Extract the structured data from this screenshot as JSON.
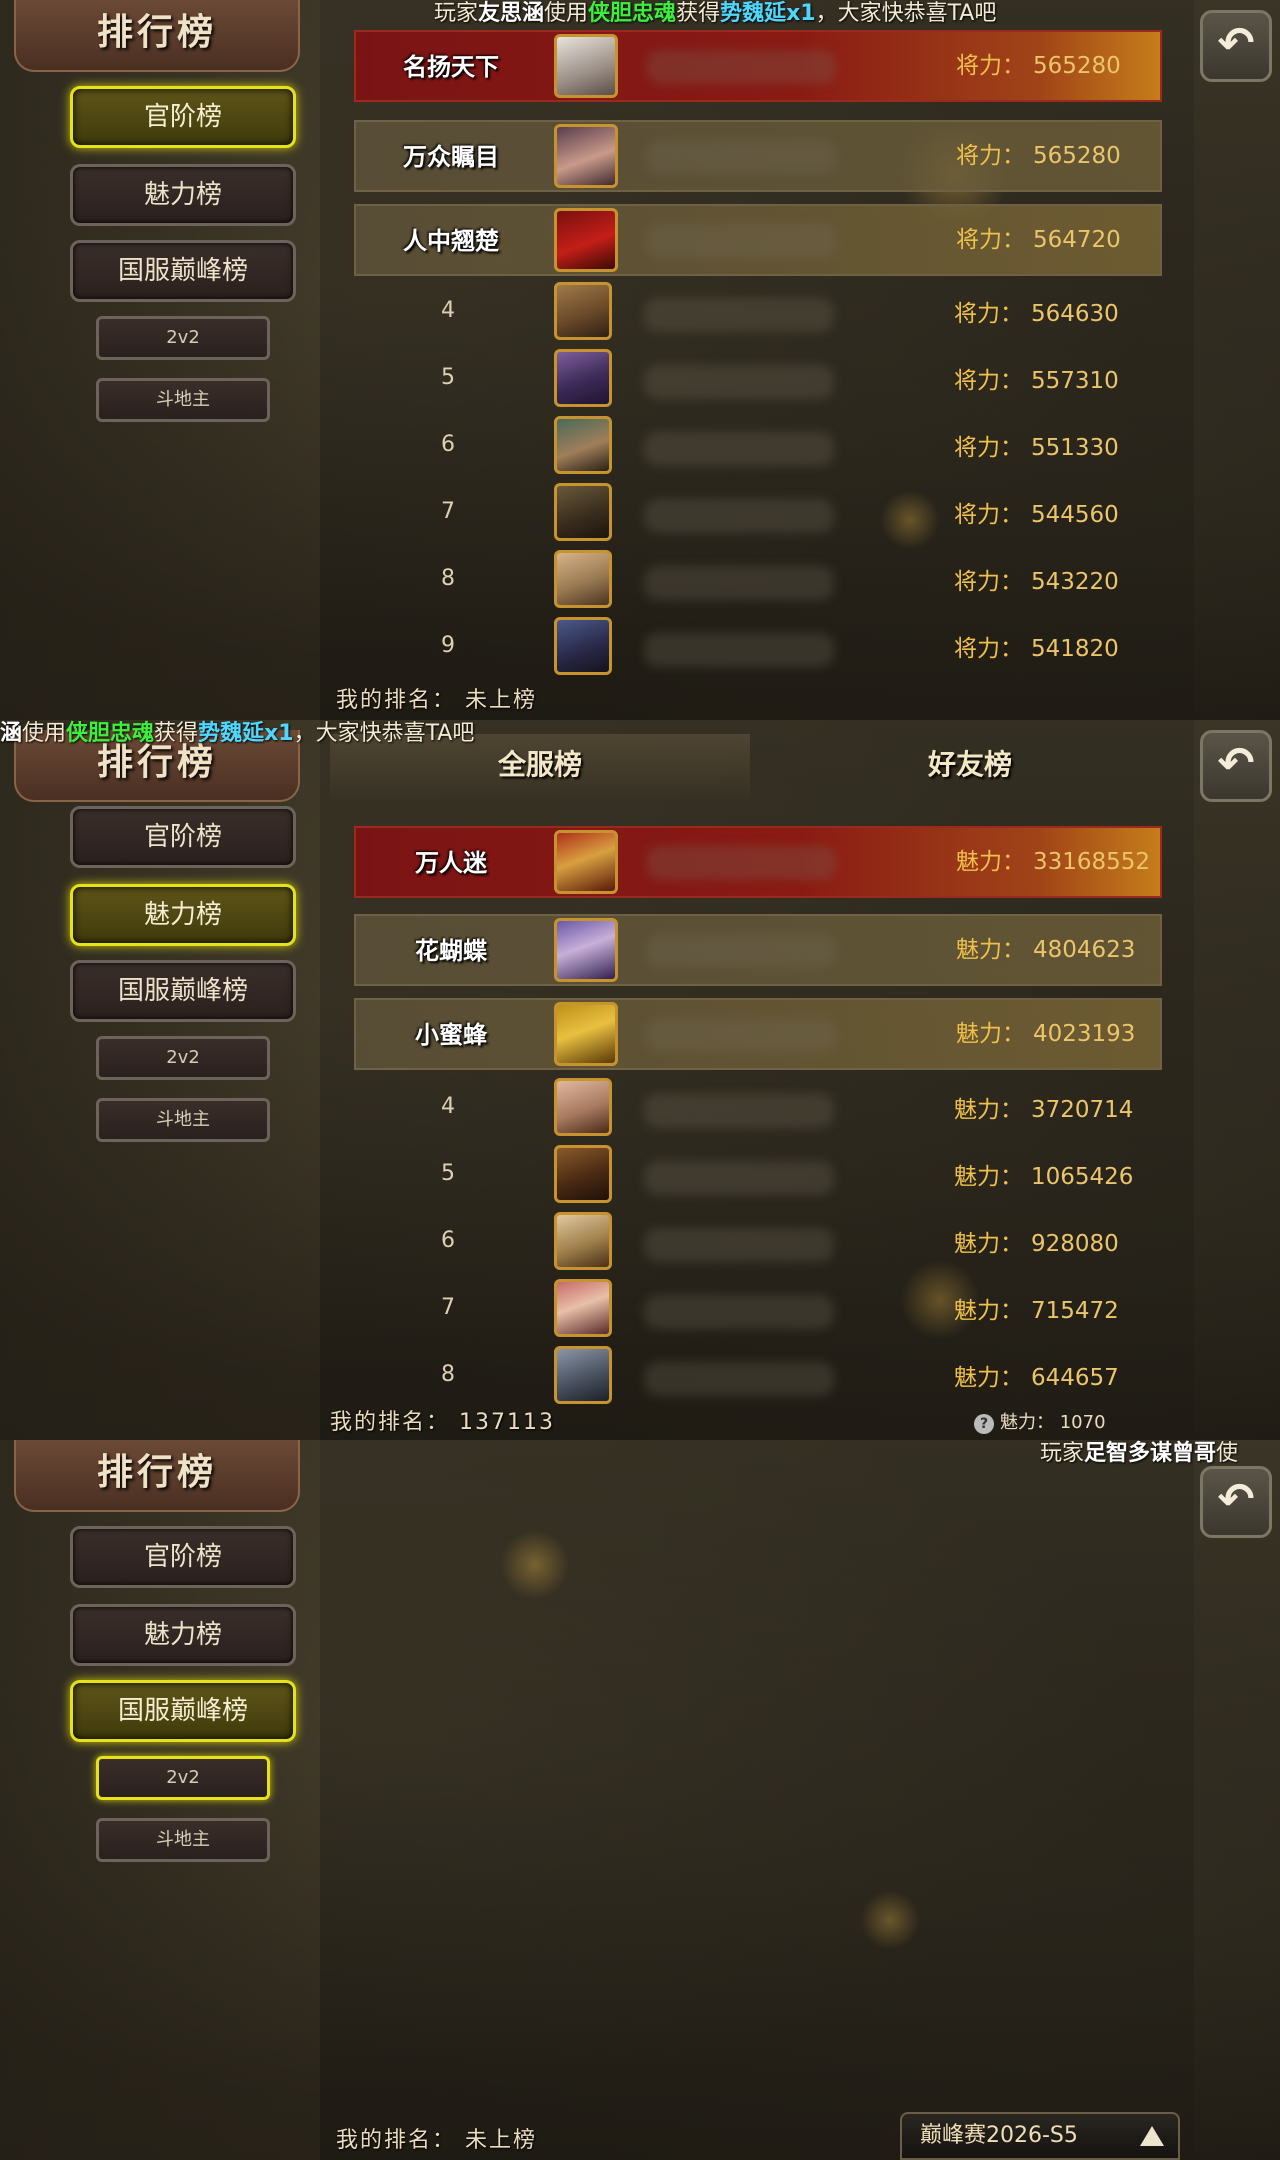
{
  "app": {
    "title": "排行榜",
    "back_icon": "↶"
  },
  "sidebar": {
    "title": "排行榜",
    "items": [
      {
        "label": "官阶榜"
      },
      {
        "label": "魅力榜"
      },
      {
        "label": "国服巅峰榜"
      },
      {
        "label": "2v2"
      },
      {
        "label": "斗地主"
      }
    ]
  },
  "ticker1": {
    "prefix": "玩家",
    "player": "友思涵",
    "mid1": "使用",
    "item": "侠胆忠魂",
    "mid2": "获得",
    "reward": "势魏延x1",
    "suffix": "，大家快恭喜TA吧"
  },
  "ticker2": {
    "player": "涵",
    "mid1": "使用",
    "item": "侠胆忠魂",
    "mid2": "获得",
    "reward": "势魏延x1",
    "suffix": "，大家快恭喜TA吧"
  },
  "ticker3": {
    "prefix": "玩家",
    "player": "足智多谋曾哥",
    "suffix": "使"
  },
  "panel1": {
    "value_label": "将力：",
    "medals": [
      "名扬天下",
      "万众瞩目",
      "人中翘楚"
    ],
    "rows": [
      {
        "rank": "1",
        "value": "565280"
      },
      {
        "rank": "2",
        "value": "565280"
      },
      {
        "rank": "3",
        "value": "564720"
      },
      {
        "rank": "4",
        "value": "564630"
      },
      {
        "rank": "5",
        "value": "557310"
      },
      {
        "rank": "6",
        "value": "551330"
      },
      {
        "rank": "7",
        "value": "544560"
      },
      {
        "rank": "8",
        "value": "543220"
      },
      {
        "rank": "9",
        "value": "541820"
      }
    ],
    "my_rank_label": "我的排名：",
    "my_rank_value": "未上榜"
  },
  "panel2": {
    "tabs": [
      "全服榜",
      "好友榜"
    ],
    "value_label": "魅力：",
    "medals": [
      "万人迷",
      "花蝴蝶",
      "小蜜蜂"
    ],
    "rows": [
      {
        "rank": "1",
        "value": "33168552"
      },
      {
        "rank": "2",
        "value": "4804623"
      },
      {
        "rank": "3",
        "value": "4023193"
      },
      {
        "rank": "4",
        "value": "3720714"
      },
      {
        "rank": "5",
        "value": "1065426"
      },
      {
        "rank": "6",
        "value": "928080"
      },
      {
        "rank": "7",
        "value": "715472"
      },
      {
        "rank": "8",
        "value": "644657"
      }
    ],
    "my_rank_label": "我的排名：",
    "my_rank_value": "137113",
    "my_score_label": "魅力：",
    "my_score_value": "1070",
    "help_icon": "?"
  },
  "panel3": {
    "my_rank_label": "我的排名：",
    "my_rank_value": "未上榜",
    "season": "巅峰赛2026-S5"
  }
}
